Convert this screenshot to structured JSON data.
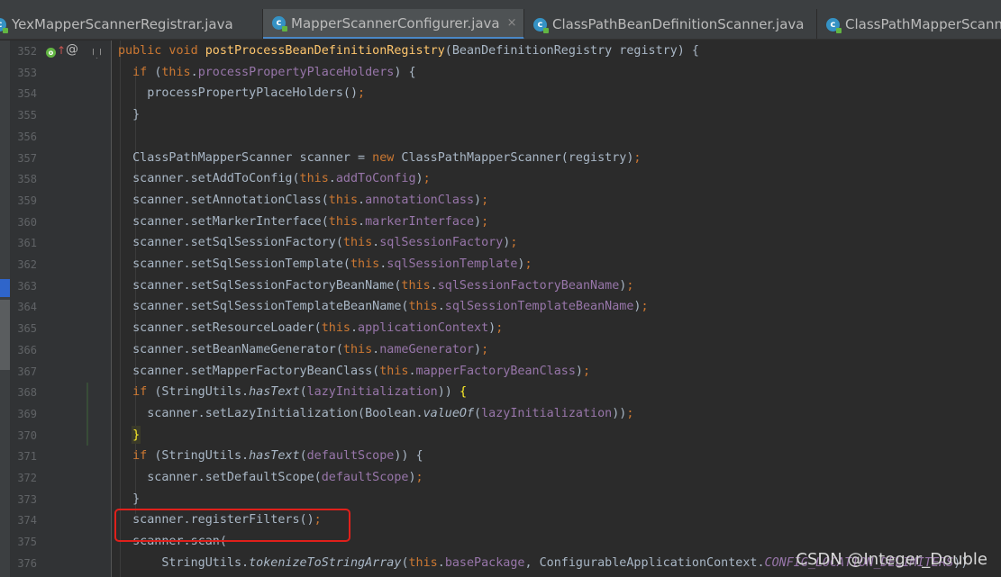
{
  "tabs": [
    {
      "label": "YexMapperScannerRegistrar.java",
      "active": false,
      "closable": false
    },
    {
      "label": "MapperScannerConfigurer.java",
      "active": true,
      "closable": true
    },
    {
      "label": "ClassPathBeanDefinitionScanner.java",
      "active": false,
      "closable": false
    },
    {
      "label": "ClassPathMapperScanne",
      "active": false,
      "closable": false
    }
  ],
  "line_numbers": [
    "352",
    "353",
    "354",
    "355",
    "356",
    "357",
    "358",
    "359",
    "360",
    "361",
    "362",
    "363",
    "364",
    "365",
    "366",
    "367",
    "368",
    "369",
    "370",
    "371",
    "372",
    "373",
    "374",
    "375",
    "376"
  ],
  "code_lines": [
    [
      [
        "k",
        "public void "
      ],
      [
        "m",
        "postProcessBeanDefinitionRegistry"
      ],
      [
        "",
        "(BeanDefinitionRegistry registry) {"
      ]
    ],
    [
      [
        "",
        "  "
      ],
      [
        "k",
        "if "
      ],
      [
        "",
        "("
      ],
      [
        "k",
        "this"
      ],
      [
        "",
        "."
      ],
      [
        "f",
        "processPropertyPlaceHolders"
      ],
      [
        "",
        ") {"
      ]
    ],
    [
      [
        "",
        "    processPropertyPlaceHolders()"
      ],
      [
        "k",
        ";"
      ]
    ],
    [
      [
        "",
        "  }"
      ]
    ],
    [
      [
        "",
        ""
      ]
    ],
    [
      [
        "",
        "  ClassPathMapperScanner scanner = "
      ],
      [
        "k",
        "new "
      ],
      [
        "",
        "ClassPathMapperScanner(registry)"
      ],
      [
        "k",
        ";"
      ]
    ],
    [
      [
        "",
        "  scanner.setAddToConfig("
      ],
      [
        "k",
        "this"
      ],
      [
        "",
        "."
      ],
      [
        "f",
        "addToConfig"
      ],
      [
        "",
        ")"
      ],
      [
        "k",
        ";"
      ]
    ],
    [
      [
        "",
        "  scanner.setAnnotationClass("
      ],
      [
        "k",
        "this"
      ],
      [
        "",
        "."
      ],
      [
        "f",
        "annotationClass"
      ],
      [
        "",
        ")"
      ],
      [
        "k",
        ";"
      ]
    ],
    [
      [
        "",
        "  scanner.setMarkerInterface("
      ],
      [
        "k",
        "this"
      ],
      [
        "",
        "."
      ],
      [
        "f",
        "markerInterface"
      ],
      [
        "",
        ")"
      ],
      [
        "k",
        ";"
      ]
    ],
    [
      [
        "",
        "  scanner.setSqlSessionFactory("
      ],
      [
        "k",
        "this"
      ],
      [
        "",
        "."
      ],
      [
        "f",
        "sqlSessionFactory"
      ],
      [
        "",
        ")"
      ],
      [
        "k",
        ";"
      ]
    ],
    [
      [
        "",
        "  scanner.setSqlSessionTemplate("
      ],
      [
        "k",
        "this"
      ],
      [
        "",
        "."
      ],
      [
        "f",
        "sqlSessionTemplate"
      ],
      [
        "",
        ")"
      ],
      [
        "k",
        ";"
      ]
    ],
    [
      [
        "",
        "  scanner.setSqlSessionFactoryBeanName("
      ],
      [
        "k",
        "this"
      ],
      [
        "",
        "."
      ],
      [
        "f",
        "sqlSessionFactoryBeanName"
      ],
      [
        "",
        ")"
      ],
      [
        "k",
        ";"
      ]
    ],
    [
      [
        "",
        "  scanner.setSqlSessionTemplateBeanName("
      ],
      [
        "k",
        "this"
      ],
      [
        "",
        "."
      ],
      [
        "f",
        "sqlSessionTemplateBeanName"
      ],
      [
        "",
        ")"
      ],
      [
        "k",
        ";"
      ]
    ],
    [
      [
        "",
        "  scanner.setResourceLoader("
      ],
      [
        "k",
        "this"
      ],
      [
        "",
        "."
      ],
      [
        "f",
        "applicationContext"
      ],
      [
        "",
        ")"
      ],
      [
        "k",
        ";"
      ]
    ],
    [
      [
        "",
        "  scanner.setBeanNameGenerator("
      ],
      [
        "k",
        "this"
      ],
      [
        "",
        "."
      ],
      [
        "f",
        "nameGenerator"
      ],
      [
        "",
        ")"
      ],
      [
        "k",
        ";"
      ]
    ],
    [
      [
        "",
        "  scanner.setMapperFactoryBeanClass("
      ],
      [
        "k",
        "this"
      ],
      [
        "",
        "."
      ],
      [
        "f",
        "mapperFactoryBeanClass"
      ],
      [
        "",
        ")"
      ],
      [
        "k",
        ";"
      ]
    ],
    [
      [
        "",
        "  "
      ],
      [
        "k",
        "if "
      ],
      [
        "",
        "(StringUtils."
      ],
      [
        "i",
        "hasText"
      ],
      [
        "",
        "("
      ],
      [
        "f",
        "lazyInitialization"
      ],
      [
        "",
        ")) "
      ],
      [
        "b",
        "{"
      ]
    ],
    [
      [
        "",
        "    scanner.setLazyInitialization(Boolean."
      ],
      [
        "i",
        "valueOf"
      ],
      [
        "",
        "("
      ],
      [
        "f",
        "lazyInitialization"
      ],
      [
        "",
        "))"
      ],
      [
        "k",
        ";"
      ]
    ],
    [
      [
        "",
        "  "
      ],
      [
        "b",
        "}"
      ]
    ],
    [
      [
        "",
        "  "
      ],
      [
        "k",
        "if "
      ],
      [
        "",
        "(StringUtils."
      ],
      [
        "i",
        "hasText"
      ],
      [
        "",
        "("
      ],
      [
        "f",
        "defaultScope"
      ],
      [
        "",
        ")) {"
      ]
    ],
    [
      [
        "",
        "    scanner.setDefaultScope("
      ],
      [
        "f",
        "defaultScope"
      ],
      [
        "",
        ")"
      ],
      [
        "k",
        ";"
      ]
    ],
    [
      [
        "",
        "  }"
      ]
    ],
    [
      [
        "",
        "  scanner.registerFilters()"
      ],
      [
        "k",
        ";"
      ]
    ],
    [
      [
        "",
        "  scanner.scan("
      ]
    ],
    [
      [
        "",
        "      StringUtils."
      ],
      [
        "i",
        "tokenizeToStringArray"
      ],
      [
        "",
        "("
      ],
      [
        "k",
        "this"
      ],
      [
        "",
        "."
      ],
      [
        "f",
        "basePackage"
      ],
      [
        "",
        ", ConfigurableApplicationContext."
      ],
      [
        "s",
        "CONFIG_LOCATION_DELIMITERS"
      ],
      [
        "",
        "))"
      ]
    ]
  ],
  "watermark": "CSDN @Integer_Double",
  "colors": {
    "background": "#2b2b2b",
    "keyword": "#cc7832",
    "field": "#9876aa",
    "method": "#ffc66d",
    "text": "#a9b7c6",
    "highlight_box": "#e0201b"
  },
  "icons": {
    "tab_file": "java-class-icon",
    "gutter": [
      "implementation-marker-icon",
      "override-up-arrow-icon",
      "annotation-at-icon",
      "fold-icon"
    ]
  }
}
